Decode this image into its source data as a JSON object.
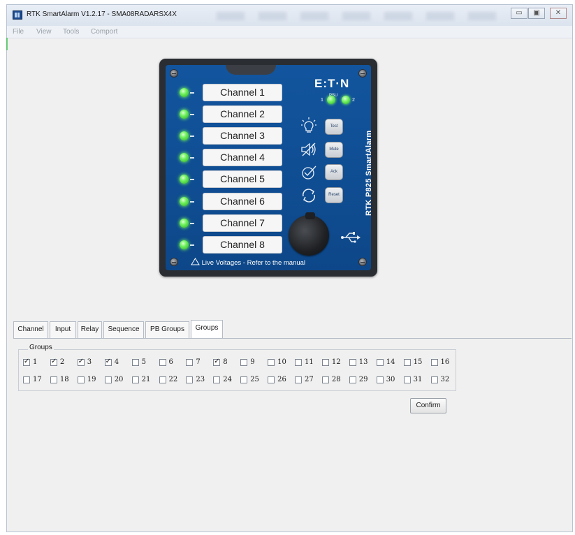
{
  "window": {
    "title": "RTK SmartAlarm V1.2.17 - SMA08RADARSX4X",
    "controls": [
      "minimize",
      "maximize",
      "close"
    ]
  },
  "menu": [
    "File",
    "View",
    "Tools",
    "Comport"
  ],
  "device": {
    "brand": "E:T·N",
    "model": "RTK P825 SmartAlarm",
    "psu_labels": [
      "1",
      "2"
    ],
    "psu_caption": "PSU",
    "channels": [
      "Channel 1",
      "Channel 2",
      "Channel 3",
      "Channel 4",
      "Channel 5",
      "Channel 6",
      "Channel 7",
      "Channel 8"
    ],
    "buttons": [
      {
        "label": "Test",
        "icon": "lightbulb-icon"
      },
      {
        "label": "Mute",
        "icon": "speaker-mute-icon"
      },
      {
        "label": "Ack",
        "icon": "check-badge-icon"
      },
      {
        "label": "Reset",
        "icon": "refresh-icon"
      }
    ],
    "warning": "Live Voltages - Refer to the manual",
    "led_color": "#6cf05a"
  },
  "tabs": [
    "Channel",
    "Input",
    "Relay",
    "Sequence",
    "PB Groups",
    "Groups"
  ],
  "active_tab": "Groups",
  "groups": {
    "legend": "Groups",
    "items": [
      {
        "label": "1",
        "checked": true
      },
      {
        "label": "2",
        "checked": true
      },
      {
        "label": "3",
        "checked": true
      },
      {
        "label": "4",
        "checked": true
      },
      {
        "label": "5",
        "checked": false
      },
      {
        "label": "6",
        "checked": false
      },
      {
        "label": "7",
        "checked": false
      },
      {
        "label": "8",
        "checked": true
      },
      {
        "label": "9",
        "checked": false
      },
      {
        "label": "10",
        "checked": false
      },
      {
        "label": "11",
        "checked": false
      },
      {
        "label": "12",
        "checked": false
      },
      {
        "label": "13",
        "checked": false
      },
      {
        "label": "14",
        "checked": false
      },
      {
        "label": "15",
        "checked": false
      },
      {
        "label": "16",
        "checked": false
      },
      {
        "label": "17",
        "checked": false
      },
      {
        "label": "18",
        "checked": false
      },
      {
        "label": "19",
        "checked": false
      },
      {
        "label": "20",
        "checked": false
      },
      {
        "label": "21",
        "checked": false
      },
      {
        "label": "22",
        "checked": false
      },
      {
        "label": "23",
        "checked": false
      },
      {
        "label": "24",
        "checked": false
      },
      {
        "label": "25",
        "checked": false
      },
      {
        "label": "26",
        "checked": false
      },
      {
        "label": "27",
        "checked": false
      },
      {
        "label": "28",
        "checked": false
      },
      {
        "label": "29",
        "checked": false
      },
      {
        "label": "30",
        "checked": false
      },
      {
        "label": "31",
        "checked": false
      },
      {
        "label": "32",
        "checked": false
      }
    ],
    "confirm_label": "Confirm"
  }
}
